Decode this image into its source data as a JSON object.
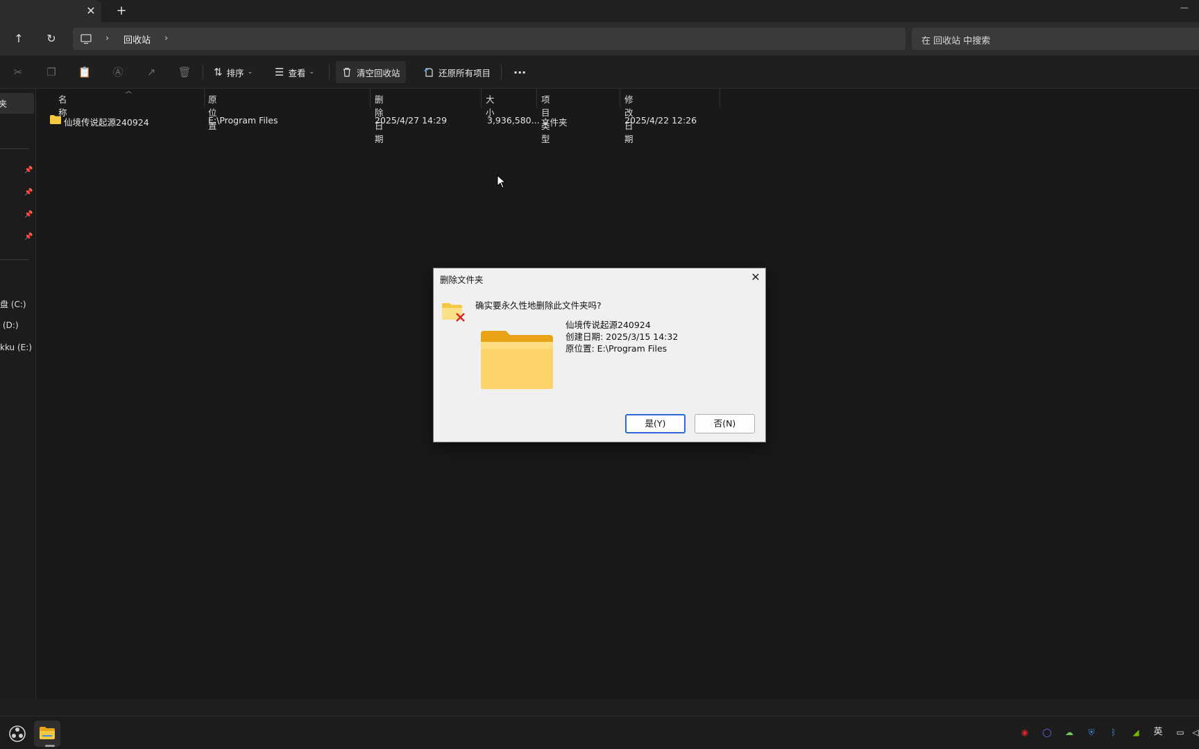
{
  "window": {
    "tab_close_glyph": "✕",
    "tab_add_glyph": "+",
    "minimize_glyph": "—"
  },
  "nav": {
    "up_glyph": "↑",
    "refresh_glyph": "↻",
    "breadcrumb": "回收站",
    "search_placeholder": "在 回收站 中搜索"
  },
  "toolbar": {
    "sort_label": "排序",
    "view_label": "查看",
    "empty_bin_label": "清空回收站",
    "restore_all_label": "还原所有项目",
    "more_glyph": "···"
  },
  "sidebar": {
    "selected_label": "夹",
    "drives": [
      "盘 (C:)",
      "(D:)",
      "kku (E:)"
    ]
  },
  "columns": [
    "名称",
    "原位置",
    "删除日期",
    "大小",
    "项目类型",
    "修改日期"
  ],
  "files": [
    {
      "name": "仙境传说起源240924",
      "original_location": "E:\\Program Files",
      "deleted_date": "2025/4/27 14:29",
      "size": "3,936,580...",
      "type": "文件夹",
      "modified_date": "2025/4/22 12:26"
    }
  ],
  "dialog": {
    "title": "删除文件夹",
    "close_glyph": "✕",
    "question": "确实要永久性地删除此文件夹吗?",
    "item_name": "仙境传说起源240924",
    "created": "创建日期: 2025/3/15 14:32",
    "location": "原位置: E:\\Program Files",
    "yes_label": "是(Y)",
    "no_label": "否(N)"
  },
  "taskbar": {
    "ime_label": "英"
  },
  "colors": {
    "folder_yellow": "#f5c842",
    "dialog_accent": "#2a6ad8",
    "delete_red": "#d8272b"
  }
}
